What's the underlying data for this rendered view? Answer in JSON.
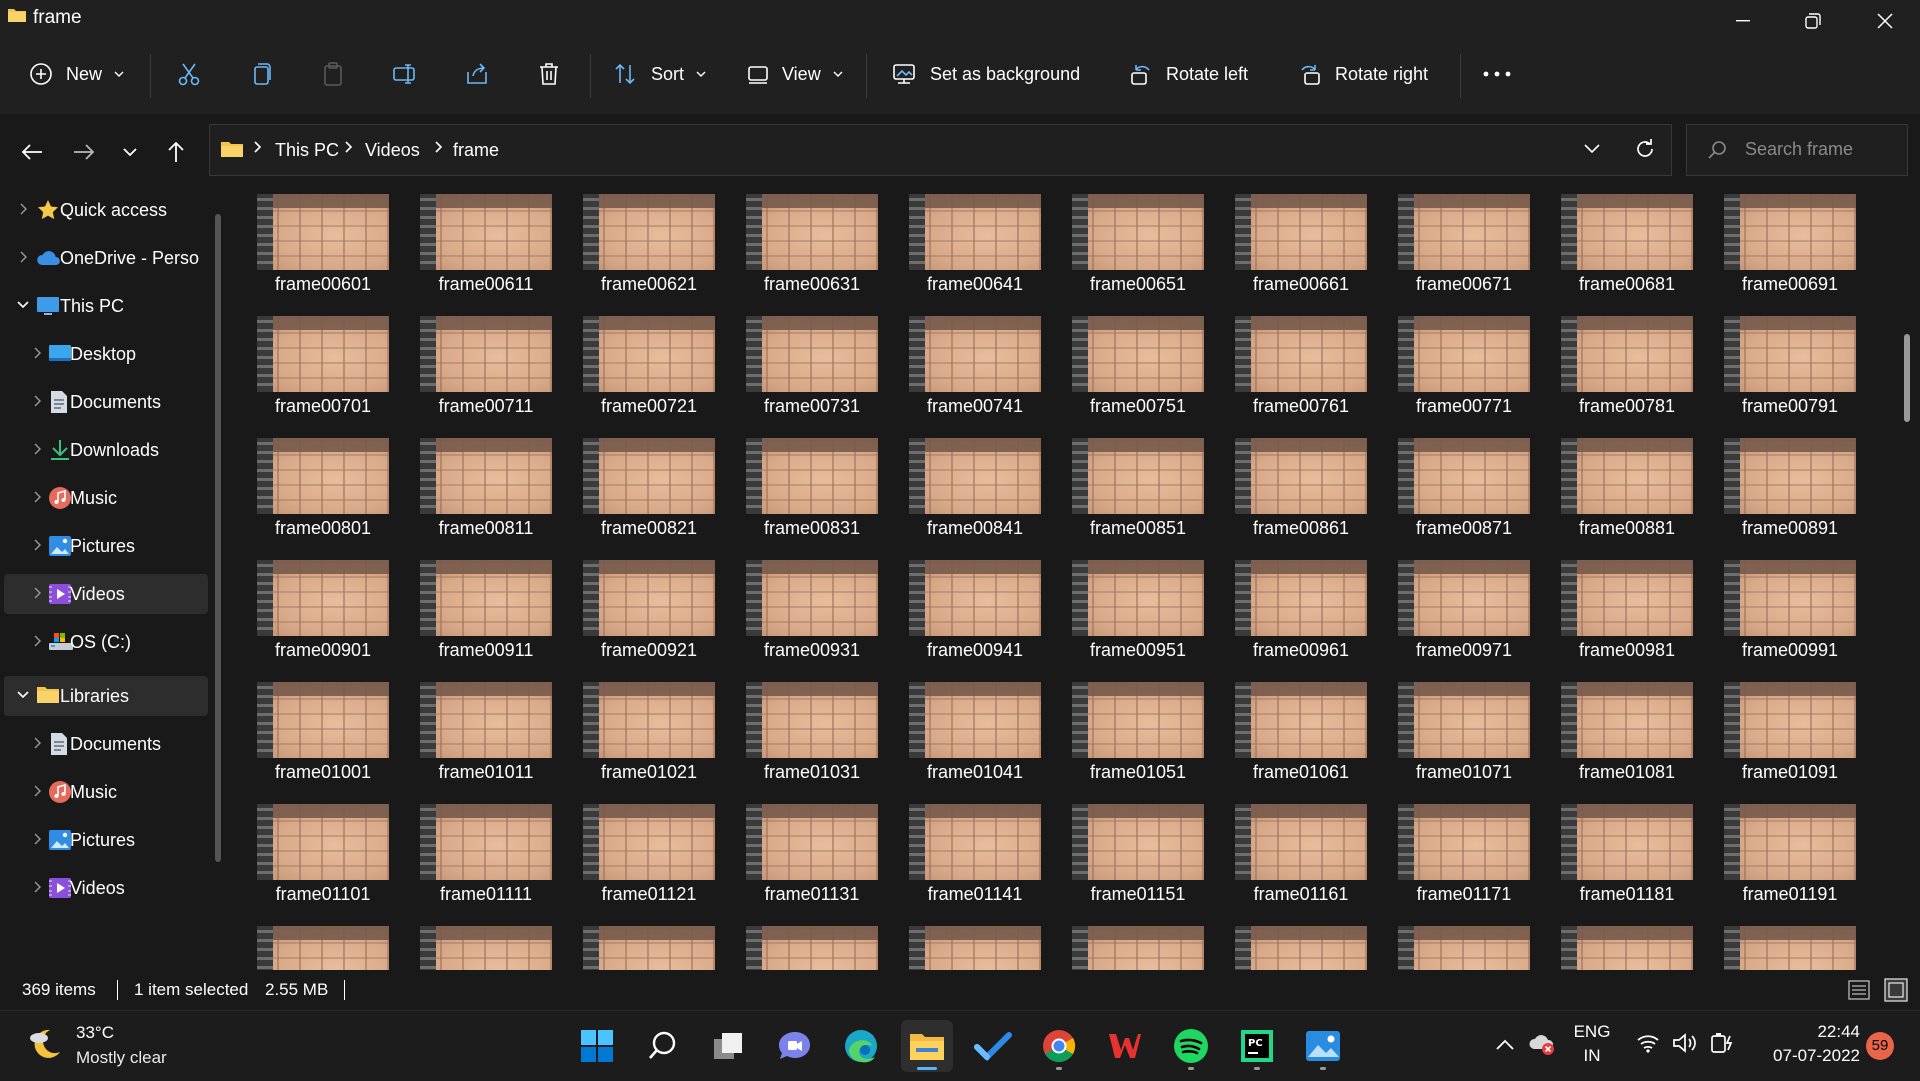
{
  "window": {
    "title": "frame"
  },
  "toolbar": {
    "new_label": "New",
    "sort_label": "Sort",
    "view_label": "View",
    "set_background_label": "Set as background",
    "rotate_left_label": "Rotate left",
    "rotate_right_label": "Rotate right"
  },
  "address": {
    "crumbs": [
      "This PC",
      "Videos",
      "frame"
    ],
    "search_placeholder": "Search frame"
  },
  "sidebar": {
    "items": [
      {
        "label": "Quick access",
        "icon": "star-icon"
      },
      {
        "label": "OneDrive - Perso",
        "icon": "cloud-icon"
      },
      {
        "label": "This PC",
        "icon": "monitor-icon"
      },
      {
        "label": "Desktop",
        "icon": "desktop-icon"
      },
      {
        "label": "Documents",
        "icon": "document-icon"
      },
      {
        "label": "Downloads",
        "icon": "download-icon"
      },
      {
        "label": "Music",
        "icon": "music-icon"
      },
      {
        "label": "Pictures",
        "icon": "pictures-icon"
      },
      {
        "label": "Videos",
        "icon": "videos-icon",
        "selected": true
      },
      {
        "label": "OS (C:)",
        "icon": "drive-icon"
      },
      {
        "label": "Libraries",
        "icon": "folder-icon",
        "selected": true
      },
      {
        "label": "Documents",
        "icon": "document-icon"
      },
      {
        "label": "Music",
        "icon": "music-icon"
      },
      {
        "label": "Pictures",
        "icon": "pictures-icon"
      },
      {
        "label": "Videos",
        "icon": "videos-icon"
      }
    ]
  },
  "files": [
    "frame00601",
    "frame00611",
    "frame00621",
    "frame00631",
    "frame00641",
    "frame00651",
    "frame00661",
    "frame00671",
    "frame00681",
    "frame00691",
    "frame00701",
    "frame00711",
    "frame00721",
    "frame00731",
    "frame00741",
    "frame00751",
    "frame00761",
    "frame00771",
    "frame00781",
    "frame00791",
    "frame00801",
    "frame00811",
    "frame00821",
    "frame00831",
    "frame00841",
    "frame00851",
    "frame00861",
    "frame00871",
    "frame00881",
    "frame00891",
    "frame00901",
    "frame00911",
    "frame00921",
    "frame00931",
    "frame00941",
    "frame00951",
    "frame00961",
    "frame00971",
    "frame00981",
    "frame00991",
    "frame01001",
    "frame01011",
    "frame01021",
    "frame01031",
    "frame01041",
    "frame01051",
    "frame01061",
    "frame01071",
    "frame01081",
    "frame01091",
    "frame01101",
    "frame01111",
    "frame01121",
    "frame01131",
    "frame01141",
    "frame01151",
    "frame01161",
    "frame01171",
    "frame01181",
    "frame01191"
  ],
  "status": {
    "item_count": "369 items",
    "selection": "1 item selected",
    "size": "2.55 MB"
  },
  "taskbar": {
    "weather_temp": "33°C",
    "weather_cond": "Mostly clear",
    "lang_top": "ENG",
    "lang_bottom": "IN",
    "time": "22:44",
    "date": "07-07-2022",
    "notification_count": "59"
  },
  "colors": {
    "accent": "#5fb2ff",
    "folder": "#f4c54a",
    "badge": "#e8654a"
  }
}
